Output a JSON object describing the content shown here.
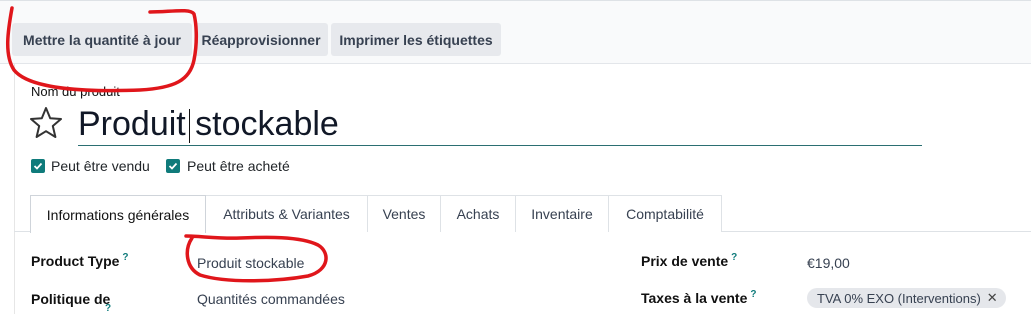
{
  "toolbar": {
    "update_qty": "Mettre la quantité à jour",
    "replenish": "Réapprovisionner",
    "print_labels": "Imprimer les étiquettes"
  },
  "product": {
    "name_label": "Nom du produit",
    "name": "Produit stockable",
    "can_be_sold": "Peut être vendu",
    "can_be_purchased": "Peut être acheté"
  },
  "tabs": [
    {
      "label": "Informations générales",
      "active": true
    },
    {
      "label": "Attributs & Variantes"
    },
    {
      "label": "Ventes"
    },
    {
      "label": "Achats"
    },
    {
      "label": "Inventaire"
    },
    {
      "label": "Comptabilité"
    }
  ],
  "fields": {
    "product_type_label": "Product Type",
    "product_type_value": "Produit stockable",
    "invoice_policy_label": "Politique de",
    "invoice_policy_value": "Quantités commandées",
    "sale_price_label": "Prix de vente",
    "sale_price_value": "€19,00",
    "sale_taxes_label": "Taxes à la vente",
    "sale_tax_tag": "TVA 0% EXO (Interventions)",
    "help_mark": "?"
  },
  "colors": {
    "accent": "#0f7b7b",
    "annotation": "#e0161b"
  }
}
